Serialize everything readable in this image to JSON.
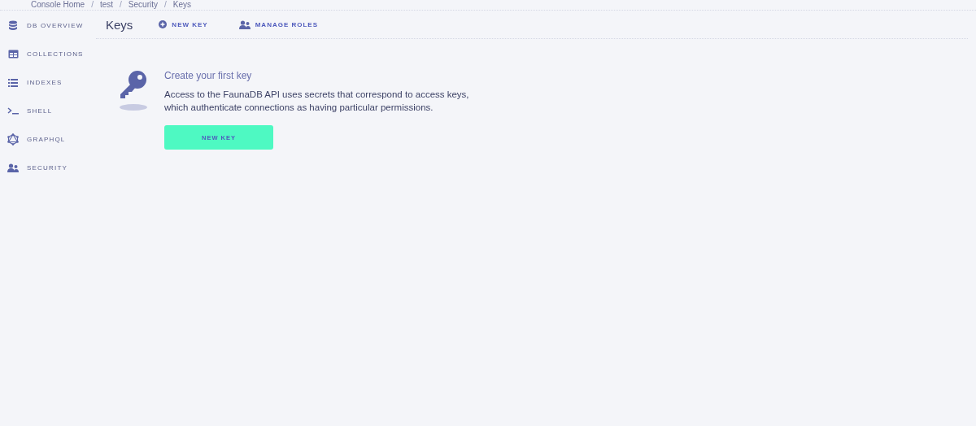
{
  "breadcrumb": {
    "separator": "/",
    "items": [
      "Console Home",
      "test",
      "Security",
      "Keys"
    ]
  },
  "sidebar": {
    "items": [
      {
        "label": "DB OVERVIEW",
        "kind": "database"
      },
      {
        "label": "COLLECTIONS",
        "kind": "table"
      },
      {
        "label": "INDEXES",
        "kind": "list"
      },
      {
        "label": "SHELL",
        "kind": "terminal"
      },
      {
        "label": "GRAPHQL",
        "kind": "graphql"
      },
      {
        "label": "SECURITY",
        "kind": "users"
      }
    ]
  },
  "header": {
    "title": "Keys",
    "actions": [
      {
        "label": "NEW KEY",
        "kind": "plus"
      },
      {
        "label": "MANAGE ROLES",
        "kind": "users"
      }
    ]
  },
  "empty_state": {
    "heading": "Create your first key",
    "body": "Access to the FaunaDB API uses secrets that correspond to access keys, which authenticate connections as having particular permissions.",
    "button": "NEW KEY"
  }
}
